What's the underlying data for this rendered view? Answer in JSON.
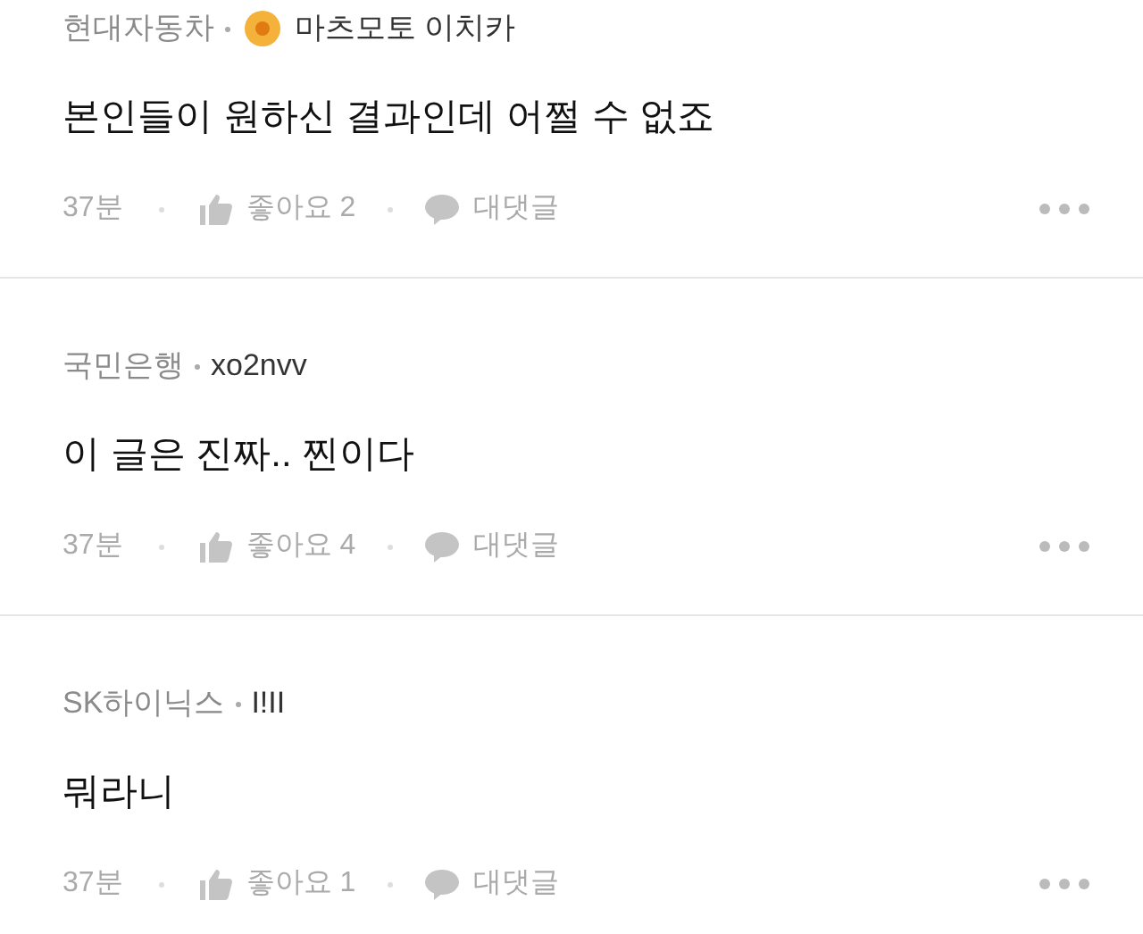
{
  "comments": [
    {
      "company": "현대자동차",
      "badge": true,
      "author": "마츠모토 이치카",
      "text": "본인들이 원하신 결과인데 어쩔 수 없죠",
      "time": "37분",
      "likes": "좋아요 2",
      "reply": "대댓글"
    },
    {
      "company": "국민은행",
      "badge": false,
      "author": "xo2nvv",
      "text": "이 글은 진짜.. 찐이다",
      "time": "37분",
      "likes": "좋아요 4",
      "reply": "대댓글"
    },
    {
      "company": "SK하이닉스",
      "badge": false,
      "author": "I!II",
      "text": "뭐라니",
      "time": "37분",
      "likes": "좋아요 1",
      "reply": "대댓글"
    }
  ]
}
